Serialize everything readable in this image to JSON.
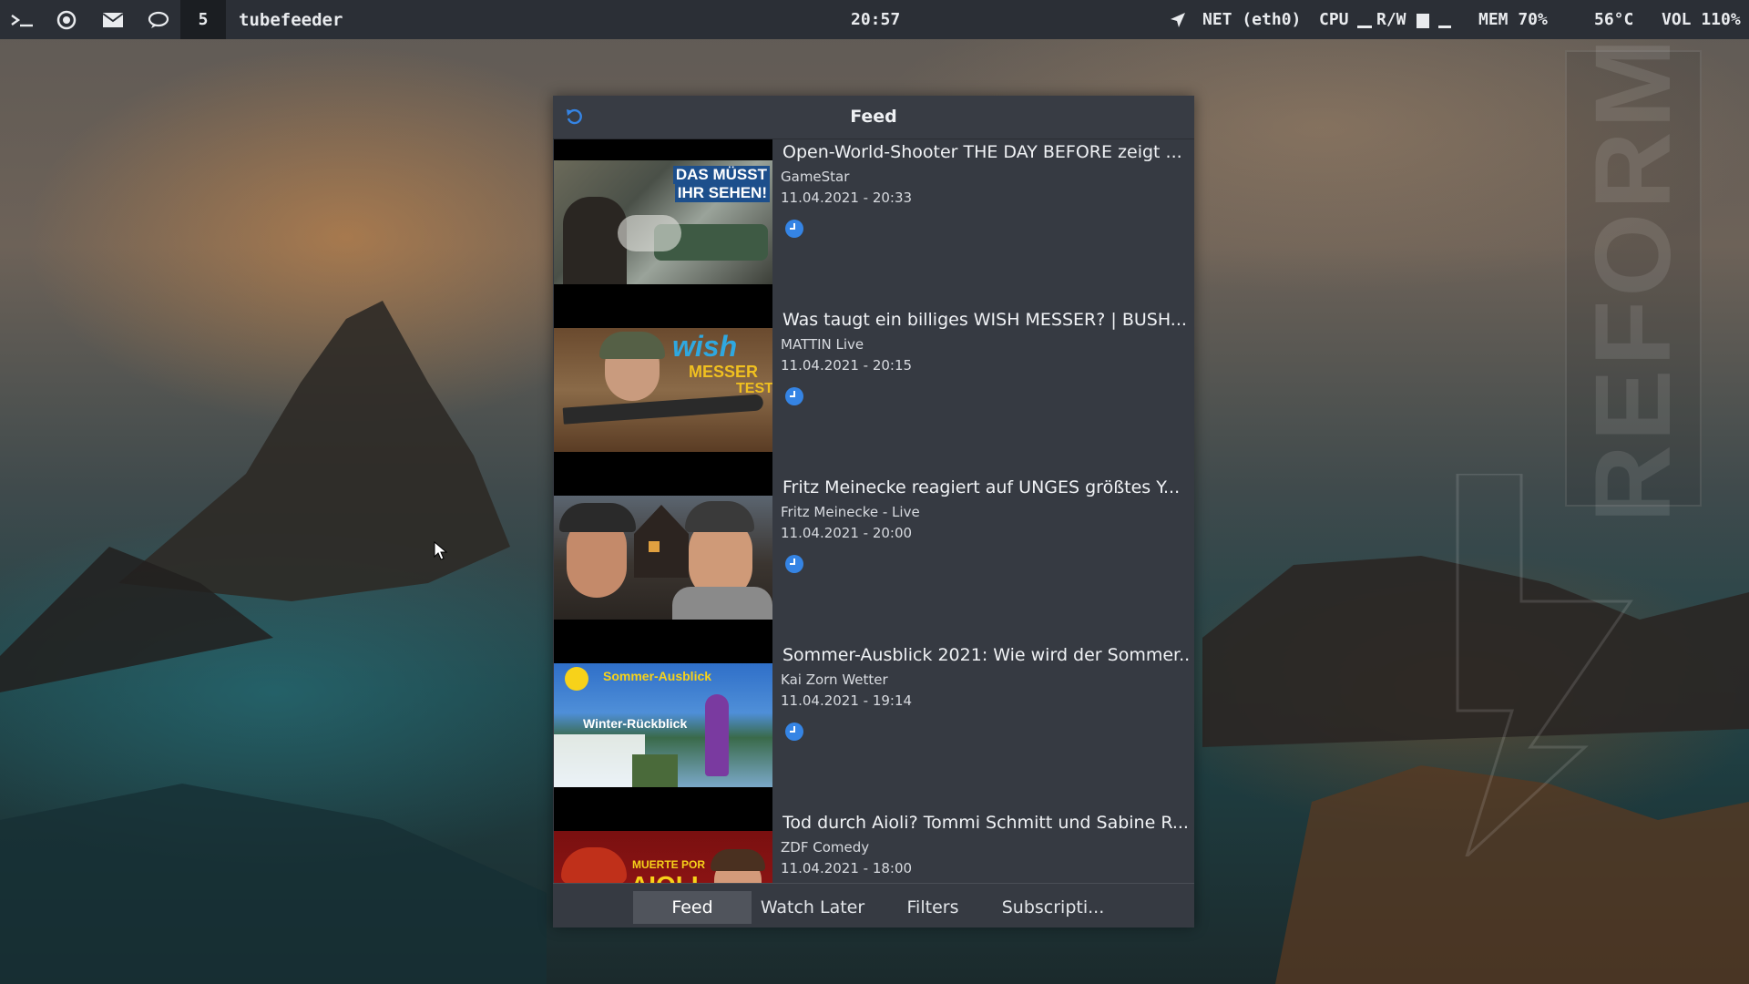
{
  "topbar": {
    "workspace": "5",
    "window_title": "tubefeeder",
    "clock": "20:57",
    "net": "NET (eth0)",
    "cpu": "CPU",
    "rw": "R/W",
    "mem": "MEM 70%",
    "temp": "56°C",
    "vol": "VOL 110%",
    "icons": [
      "terminal-icon",
      "browser-icon",
      "mail-icon",
      "chat-icon",
      "location-arrow-icon"
    ]
  },
  "wallpaper": {
    "watermark": "REFORM"
  },
  "app": {
    "title": "Feed",
    "refresh_icon": "refresh-icon",
    "videos": [
      {
        "title": "Open-World-Shooter THE DAY BEFORE zeigt ...",
        "channel": "GameStar",
        "date": "11.04.2021 - 20:33",
        "thumb_text": [
          "DAS MÜSST",
          "IHR SEHEN!"
        ]
      },
      {
        "title": "Was taugt ein billiges WISH MESSER? | BUSH...",
        "channel": "MATTIN Live",
        "date": "11.04.2021 - 20:15",
        "thumb_text": [
          "wish",
          "MESSER",
          "TEST"
        ]
      },
      {
        "title": "Fritz Meinecke reagiert auf UNGES größtes Y...",
        "channel": "Fritz Meinecke - Live",
        "date": "11.04.2021 - 20:00",
        "thumb_text": []
      },
      {
        "title": "Sommer-Ausblick 2021: Wie wird der Sommer...",
        "channel": "Kai Zorn Wetter",
        "date": "11.04.2021 - 19:14",
        "thumb_text": [
          "Sommer-Ausblick",
          "Winter-Rückblick"
        ]
      },
      {
        "title": "Tod durch Aioli? Tommi Schmitt und Sabine R...",
        "channel": "ZDF Comedy",
        "date": "11.04.2021 - 18:00",
        "thumb_text": [
          "MUERTE POR",
          "AIOLI"
        ]
      }
    ],
    "tabs": [
      "Feed",
      "Watch Later",
      "Filters",
      "Subscripti..."
    ],
    "active_tab": "Feed",
    "accent": "#3584e4"
  }
}
